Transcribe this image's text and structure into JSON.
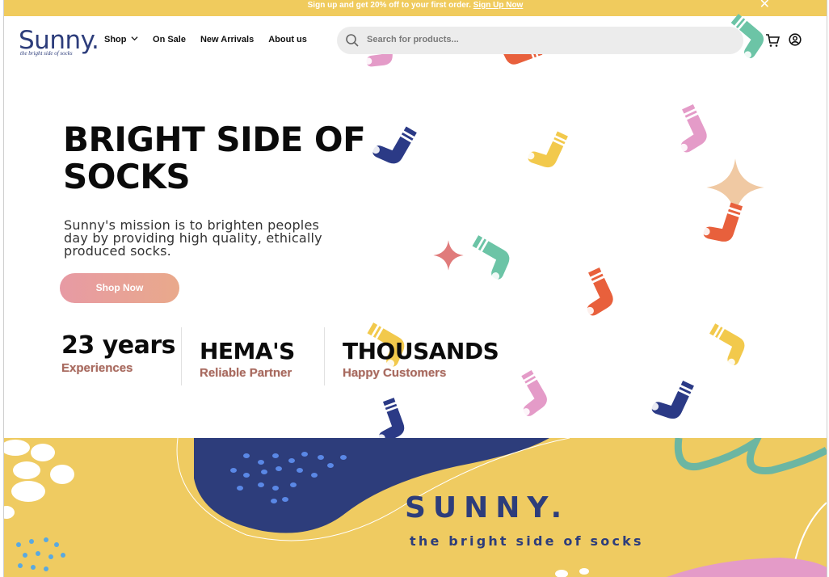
{
  "promo": {
    "text": "Sign up and get 20% off to your first order.",
    "link": "Sign Up Now"
  },
  "logo": {
    "word": "Sunny.",
    "tagline": "the bright side of socks"
  },
  "nav": {
    "items": [
      "Shop",
      "On Sale",
      "New Arrivals",
      "About us"
    ]
  },
  "search": {
    "placeholder": "Search for products..."
  },
  "header_icons": [
    "search-icon",
    "cart-icon",
    "account-icon",
    "close-icon",
    "chevron-down-icon"
  ],
  "hero": {
    "title": "BRIGHT SIDE OF SOCKS",
    "mission": "Sunny's mission is to brighten peoples day by providing high quality, ethically produced socks.",
    "cta": "Shop Now"
  },
  "stats": [
    {
      "big": "23 years",
      "sub": "Experiences"
    },
    {
      "big": "HEMA'S",
      "sub": "Reliable Partner"
    },
    {
      "big": "THOUSANDS",
      "sub": "Happy Customers"
    }
  ],
  "banner": {
    "title": "SUNNY.",
    "subtitle": "the bright side of socks"
  },
  "colors": {
    "promo_bar": "#f0cb5d",
    "brand_navy": "#2d3d7b",
    "stat_sub": "#a86a5f",
    "sock_pink": "#e49bc8",
    "sock_orange": "#e8603c",
    "sock_teal": "#6cc4a6",
    "sock_yellow": "#f2c94c",
    "sock_navy": "#2b3a86",
    "banner_yellow": "#efcb61"
  }
}
